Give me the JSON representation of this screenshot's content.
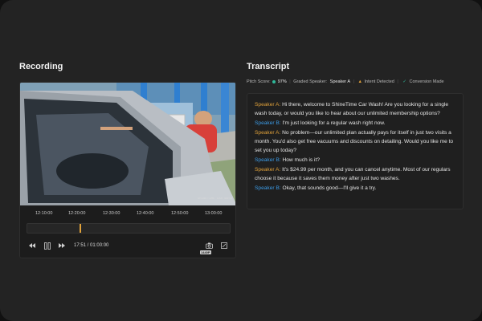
{
  "recording": {
    "title": "Recording",
    "watermark": "SHINETIME CAR WASH",
    "timeline_labels": [
      "12:10:00",
      "12:20:00",
      "12:30:00",
      "12:40:00",
      "12:50:00",
      "13:00:00"
    ],
    "playhead_position_fraction": 0.26,
    "time_readout": "17:51 / 01:00:00",
    "quality_badge": "1440P",
    "controls": {
      "rewind_icon": "skip-back-icon",
      "pause_icon": "pause-icon",
      "forward_icon": "skip-forward-icon",
      "snapshot_icon": "camera-icon",
      "fullscreen_icon": "expand-icon"
    }
  },
  "transcript": {
    "title": "Transcript",
    "meta": {
      "pitch_label": "Pitch Score:",
      "pitch_value": "97%",
      "graded_label": "Graded Speaker:",
      "graded_value": "Speaker A",
      "intent": "Intent Detected",
      "conversion": "Conversion Made"
    },
    "lines": [
      {
        "speaker": "Speaker A:",
        "text": "Hi there, welcome to ShineTime Car Wash! Are you looking for a single wash today, or would you like to hear about our unlimited membership options?"
      },
      {
        "speaker": "Speaker B:",
        "text": "I'm just looking for a regular wash right now."
      },
      {
        "speaker": "Speaker A:",
        "text": "No problem—our unlimited plan actually pays for itself in just two visits a month. You'd also get free vacuums and discounts on detailing. Would you like me to set you up today?"
      },
      {
        "speaker": "Speaker B:",
        "text": "How much is it?"
      },
      {
        "speaker": "Speaker A:",
        "text": "It's $24.99 per month, and you can cancel anytime. Most of our regulars choose it because it saves them money after just two washes."
      },
      {
        "speaker": "Speaker B:",
        "text": "Okay, that sounds good—I'll give it a try."
      }
    ]
  },
  "colors": {
    "speaker_a": "#e0a13a",
    "speaker_b": "#3b9be6",
    "accent_green": "#2fb89a",
    "background": "#232323"
  }
}
